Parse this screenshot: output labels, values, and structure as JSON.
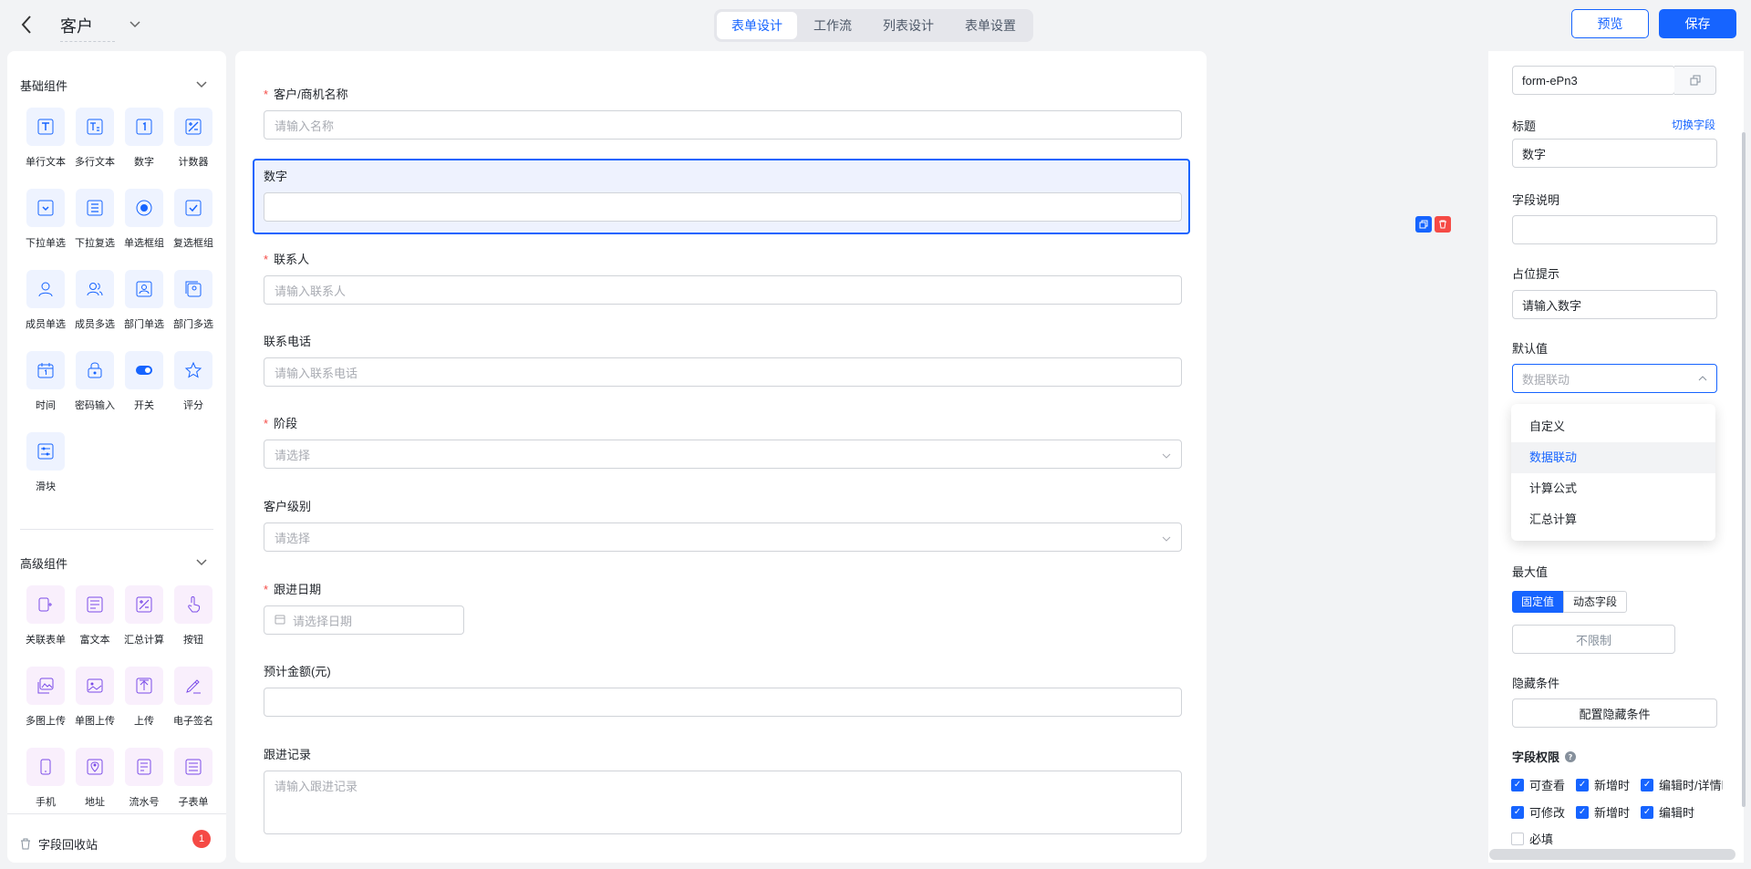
{
  "header": {
    "back_icon": "chevron-left-icon",
    "app_name": "客户",
    "tabs": [
      "表单设计",
      "工作流",
      "列表设计",
      "表单设置"
    ],
    "active_tab": "表单设计",
    "preview_label": "预览",
    "save_label": "保存"
  },
  "left_panel": {
    "basic_title": "基础组件",
    "basic": [
      {
        "label": "单行文本",
        "icon": "text-icon"
      },
      {
        "label": "多行文本",
        "icon": "textarea-icon"
      },
      {
        "label": "数字",
        "icon": "number-icon"
      },
      {
        "label": "计数器",
        "icon": "counter-icon"
      },
      {
        "label": "下拉单选",
        "icon": "dropdown-icon"
      },
      {
        "label": "下拉复选",
        "icon": "dropdown-multi-icon"
      },
      {
        "label": "单选框组",
        "icon": "radio-icon"
      },
      {
        "label": "复选框组",
        "icon": "checkbox-icon"
      },
      {
        "label": "成员单选",
        "icon": "user-icon"
      },
      {
        "label": "成员多选",
        "icon": "users-icon"
      },
      {
        "label": "部门单选",
        "icon": "dept-icon"
      },
      {
        "label": "部门多选",
        "icon": "dept-multi-icon"
      },
      {
        "label": "时间",
        "icon": "calendar-icon"
      },
      {
        "label": "密码输入",
        "icon": "lock-icon"
      },
      {
        "label": "开关",
        "icon": "toggle-icon"
      },
      {
        "label": "评分",
        "icon": "star-icon"
      },
      {
        "label": "滑块",
        "icon": "slider-icon"
      }
    ],
    "advanced_title": "高级组件",
    "advanced": [
      {
        "label": "关联表单",
        "icon": "link-form-icon"
      },
      {
        "label": "富文本",
        "icon": "rich-text-icon"
      },
      {
        "label": "汇总计算",
        "icon": "sum-icon"
      },
      {
        "label": "按钮",
        "icon": "button-icon"
      },
      {
        "label": "多图上传",
        "icon": "images-icon"
      },
      {
        "label": "单图上传",
        "icon": "image-icon"
      },
      {
        "label": "上传",
        "icon": "upload-icon"
      },
      {
        "label": "电子签名",
        "icon": "signature-icon"
      },
      {
        "label": "手机",
        "icon": "phone-icon"
      },
      {
        "label": "地址",
        "icon": "location-icon"
      },
      {
        "label": "流水号",
        "icon": "serial-icon"
      },
      {
        "label": "子表单",
        "icon": "subform-icon"
      }
    ],
    "recycle_label": "字段回收站",
    "recycle_count": "1"
  },
  "form": {
    "fields": [
      {
        "label": "客户/商机名称",
        "required": true,
        "placeholder": "请输入名称"
      },
      {
        "label": "数字",
        "required": false,
        "placeholder": ""
      },
      {
        "label": "联系人",
        "required": true,
        "placeholder": "请输入联系人"
      },
      {
        "label": "联系电话",
        "required": false,
        "placeholder": "请输入联系电话"
      },
      {
        "label": "阶段",
        "required": true,
        "placeholder": "请选择"
      },
      {
        "label": "客户级别",
        "required": false,
        "placeholder": "请选择"
      },
      {
        "label": "跟进日期",
        "required": true,
        "placeholder": "请选择日期"
      },
      {
        "label": "预计金额(元)",
        "required": false,
        "placeholder": ""
      },
      {
        "label": "跟进记录",
        "required": false,
        "placeholder": "请输入跟进记录"
      }
    ]
  },
  "props": {
    "field_id": "form-ePn3",
    "title_label": "标题",
    "switch_field": "切换字段",
    "title_value": "数字",
    "desc_label": "字段说明",
    "placeholder_label": "占位提示",
    "placeholder_value": "请输入数字",
    "default_label": "默认值",
    "default_value": "数据联动",
    "default_options": [
      "自定义",
      "数据联动",
      "计算公式",
      "汇总计算"
    ],
    "max_label": "最大值",
    "max_modes": [
      "固定值",
      "动态字段"
    ],
    "max_value": "不限制",
    "hidden_label": "隐藏条件",
    "hidden_btn": "配置隐藏条件",
    "perm_label": "字段权限",
    "perm_row1": [
      "可查看",
      "新增时",
      "编辑时/详情时"
    ],
    "perm_row2": [
      "可修改",
      "新增时",
      "编辑时"
    ],
    "required_label": "必填"
  }
}
